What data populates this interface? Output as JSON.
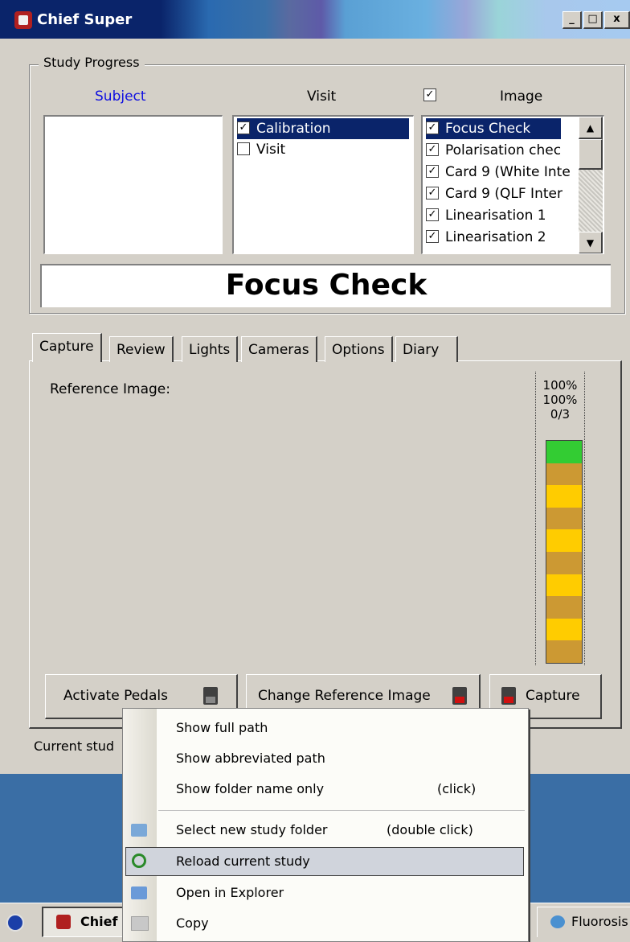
{
  "window": {
    "title": "Chief Super",
    "min_label": "_",
    "max_label": "□",
    "close_label": "x"
  },
  "study_progress": {
    "legend": "Study Progress",
    "subject_header": "Subject",
    "visit_header": "Visit",
    "image_header": "Image",
    "image_header_checked": "✓",
    "visits": [
      {
        "label": "Calibration",
        "checked": "✓"
      },
      {
        "label": "Visit",
        "checked": ""
      }
    ],
    "images": [
      {
        "label": "Focus Check",
        "checked": "✓"
      },
      {
        "label": "Polarisation chec",
        "checked": "✓"
      },
      {
        "label": "Card 9 (White Inte",
        "checked": "✓"
      },
      {
        "label": "Card 9 (QLF Inter",
        "checked": "✓"
      },
      {
        "label": "Linearisation 1",
        "checked": "✓"
      },
      {
        "label": "Linearisation 2",
        "checked": "✓"
      }
    ],
    "current_image_banner": "Focus Check"
  },
  "tabs": [
    "Capture",
    "Review",
    "Lights",
    "Cameras",
    "Options",
    "Diary"
  ],
  "capture": {
    "reference_label": "Reference Image:",
    "meter": {
      "line1": "100%",
      "line2": "100%",
      "line3": "0/3",
      "green": "#33cc33",
      "gold": "#ffcc00",
      "brown": "#cc9933"
    },
    "activate_pedals": "Activate Pedals",
    "change_reference": "Change Reference Image",
    "capture": "Capture"
  },
  "status": {
    "current_study_prefix": "Current stud"
  },
  "context_menu": {
    "items": [
      {
        "label": "Show full path",
        "hint": ""
      },
      {
        "label": "Show abbreviated path",
        "hint": ""
      },
      {
        "label": "Show folder name only",
        "hint": "(click)"
      },
      {
        "label": "Select new study folder",
        "hint": "(double click)"
      },
      {
        "label": "Reload current study",
        "hint": ""
      },
      {
        "label": "Open in Explorer",
        "hint": ""
      },
      {
        "label": "Copy",
        "hint": ""
      }
    ]
  },
  "taskbar": {
    "chief_button": "Chief",
    "fluorosis_button": "Fluorosis"
  }
}
